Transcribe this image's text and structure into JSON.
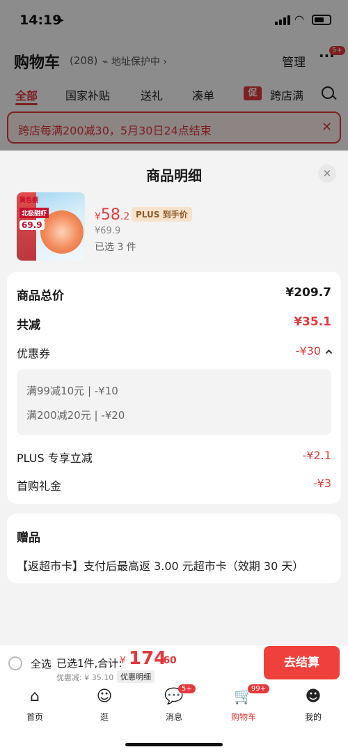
{
  "status": {
    "time": "14:19"
  },
  "cart": {
    "title": "购物车",
    "count": "(208)",
    "address": "地址保护中",
    "manage": "管理",
    "more_badge": "5+"
  },
  "tabs": [
    "全部",
    "国家补贴",
    "送礼",
    "凑单",
    "跨店满"
  ],
  "tab_icon_text": "促",
  "promo": {
    "text": "跨店每满200减30，5月30日24点结束"
  },
  "sheet": {
    "title": "商品明细",
    "product": {
      "price_yen": "¥",
      "price_int": "58",
      "price_dec": ".2",
      "plus_tag": "PLUS 到手价",
      "orig_price": "¥69.9",
      "qty": "已选 3 件",
      "img_brand": "黄色棚",
      "img_title": "北极甜虾",
      "img_price": "69.9"
    },
    "summary": {
      "total_label": "商品总价",
      "total_value": "¥209.7",
      "reduce_label": "共减",
      "reduce_value": "¥35.1",
      "coupon_label": "优惠券",
      "coupon_value": "-¥30",
      "coupon_lines": [
        "满99减10元 | -¥10",
        "满200减20元 | -¥20"
      ],
      "plus_label": "PLUS 专享立减",
      "plus_value": "-¥2.1",
      "first_label": "首购礼金",
      "first_value": "-¥3"
    },
    "gift": {
      "title": "赠品",
      "text": "【返超市卡】支付后最高返 3.00 元超市卡（效期 30 天）"
    }
  },
  "checkout": {
    "all": "全选",
    "selected": "已选1件,合计:",
    "yen": "¥",
    "total_int": "174",
    "total_dec": ".60",
    "discount": "优惠减: ¥ 35.10",
    "detail": "优惠明细",
    "go": "去结算"
  },
  "tabbar": [
    {
      "label": "首页",
      "icon": "home-icon"
    },
    {
      "label": "逛",
      "icon": "stroll-icon"
    },
    {
      "label": "消息",
      "icon": "message-icon",
      "badge": "5+"
    },
    {
      "label": "购物车",
      "icon": "cart-icon",
      "badge": "99+"
    },
    {
      "label": "我的",
      "icon": "profile-icon"
    }
  ],
  "colors": {
    "accent": "#e4393c",
    "plus": "#f7e2cc"
  }
}
